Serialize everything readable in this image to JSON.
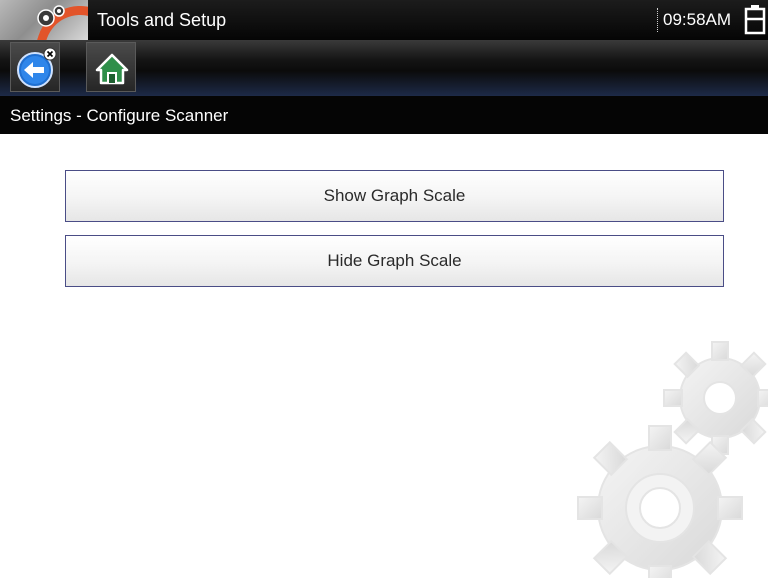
{
  "titlebar": {
    "title": "Tools and Setup",
    "time": "09:58AM",
    "app_icon": "tools-gear-icon",
    "battery_icon": "battery-icon"
  },
  "toolbar": {
    "back_icon": "back-arrow-icon",
    "home_icon": "home-icon"
  },
  "breadcrumb": {
    "text": "Settings - Configure Scanner"
  },
  "options": [
    {
      "label": "Show Graph Scale"
    },
    {
      "label": "Hide Graph Scale"
    }
  ],
  "colors": {
    "bar": "#050505",
    "option_border": "#4a4d86",
    "back_button": "#1f6fd0",
    "home_button": "#2f8f4a"
  }
}
